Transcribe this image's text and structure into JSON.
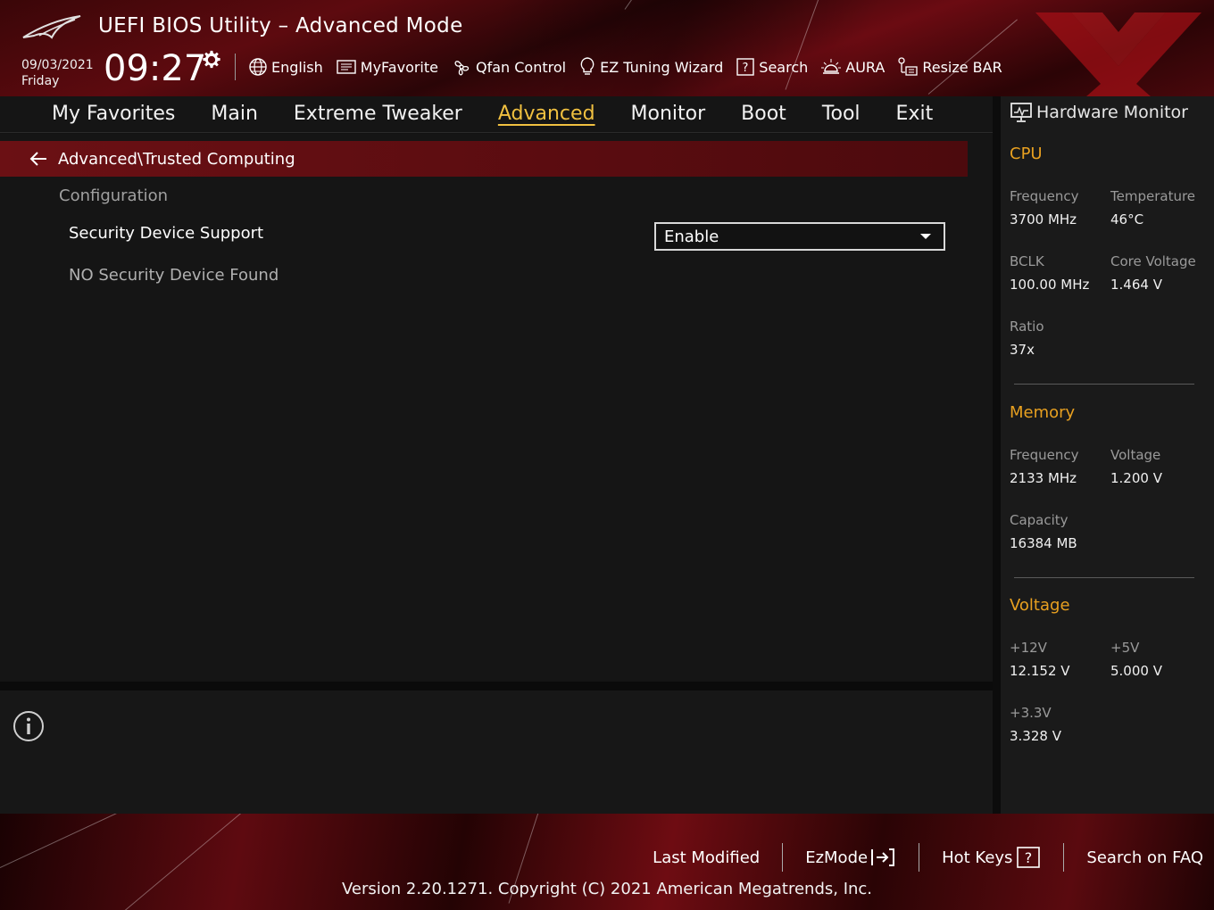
{
  "header": {
    "title": "UEFI BIOS Utility – Advanced Mode",
    "date": "09/03/2021",
    "day": "Friday",
    "time": "09:27"
  },
  "toolbar": {
    "items": [
      {
        "label": "English",
        "icon": "globe-icon"
      },
      {
        "label": "MyFavorite",
        "icon": "favorite-list-icon"
      },
      {
        "label": "Qfan Control",
        "icon": "fan-icon"
      },
      {
        "label": "EZ Tuning Wizard",
        "icon": "lightbulb-icon"
      },
      {
        "label": "Search",
        "icon": "help-search-icon"
      },
      {
        "label": "AURA",
        "icon": "aura-light-icon"
      },
      {
        "label": "Resize BAR",
        "icon": "resize-bar-icon"
      }
    ]
  },
  "menu": {
    "tabs": [
      {
        "label": "My Favorites",
        "active": false
      },
      {
        "label": "Main",
        "active": false
      },
      {
        "label": "Extreme Tweaker",
        "active": false
      },
      {
        "label": "Advanced",
        "active": true
      },
      {
        "label": "Monitor",
        "active": false
      },
      {
        "label": "Boot",
        "active": false
      },
      {
        "label": "Tool",
        "active": false
      },
      {
        "label": "Exit",
        "active": false
      }
    ]
  },
  "main": {
    "breadcrumb": "Advanced\\Trusted Computing",
    "section_title": "Configuration",
    "setting": {
      "label": "Security Device Support",
      "value": "Enable"
    },
    "status_text": "NO Security Device Found"
  },
  "hardware_monitor": {
    "title": "Hardware Monitor",
    "cpu": {
      "title": "CPU",
      "frequency_label": "Frequency",
      "frequency": "3700 MHz",
      "temperature_label": "Temperature",
      "temperature": "46°C",
      "bclk_label": "BCLK",
      "bclk": "100.00 MHz",
      "core_voltage_label": "Core Voltage",
      "core_voltage": "1.464 V",
      "ratio_label": "Ratio",
      "ratio": "37x"
    },
    "memory": {
      "title": "Memory",
      "frequency_label": "Frequency",
      "frequency": "2133 MHz",
      "voltage_label": "Voltage",
      "voltage": "1.200 V",
      "capacity_label": "Capacity",
      "capacity": "16384 MB"
    },
    "voltage": {
      "title": "Voltage",
      "v12_label": "+12V",
      "v12": "12.152 V",
      "v5_label": "+5V",
      "v5": "5.000 V",
      "v33_label": "+3.3V",
      "v33": "3.328 V"
    }
  },
  "footer": {
    "last_modified": "Last Modified",
    "ezmode": "EzMode",
    "hot_keys": "Hot Keys",
    "search_faq": "Search on FAQ",
    "version": "Version 2.20.1271. Copyright (C) 2021 American Megatrends, Inc."
  },
  "colors": {
    "accent_gold": "#f0c040",
    "category_orange": "#e8a020",
    "brand_red": "#6b1014"
  }
}
